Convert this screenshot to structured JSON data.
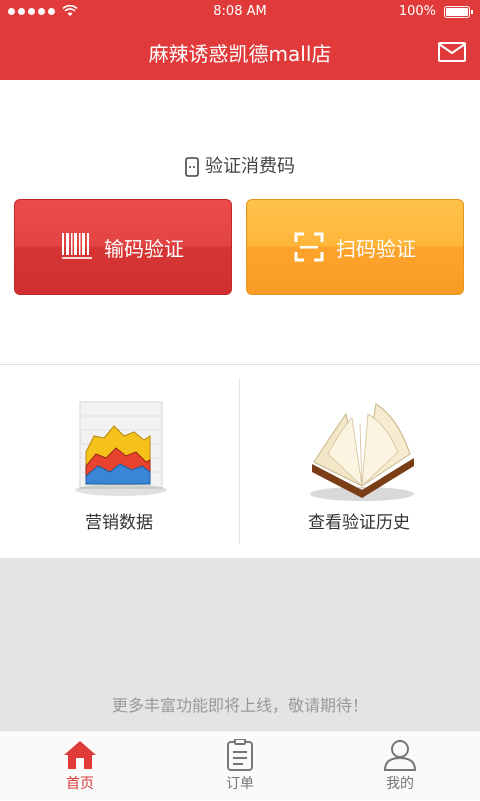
{
  "status_bar": {
    "time": "8:08 AM",
    "battery": "100%"
  },
  "header": {
    "title": "麻辣诱惑凯德mall店",
    "mail_icon": "mail-icon"
  },
  "verify": {
    "title": "验证消费码",
    "input_button": "输码验证",
    "scan_button": "扫码验证"
  },
  "tiles": {
    "marketing": "营销数据",
    "history": "查看验证历史"
  },
  "notice": "更多丰富功能即将上线，敬请期待！",
  "tabs": [
    {
      "label": "首页",
      "icon": "home-icon",
      "active": true
    },
    {
      "label": "订单",
      "icon": "order-icon",
      "active": false
    },
    {
      "label": "我的",
      "icon": "user-icon",
      "active": false
    }
  ],
  "colors": {
    "brand_red": "#e03a3a",
    "accent_orange": "#fda32b"
  }
}
